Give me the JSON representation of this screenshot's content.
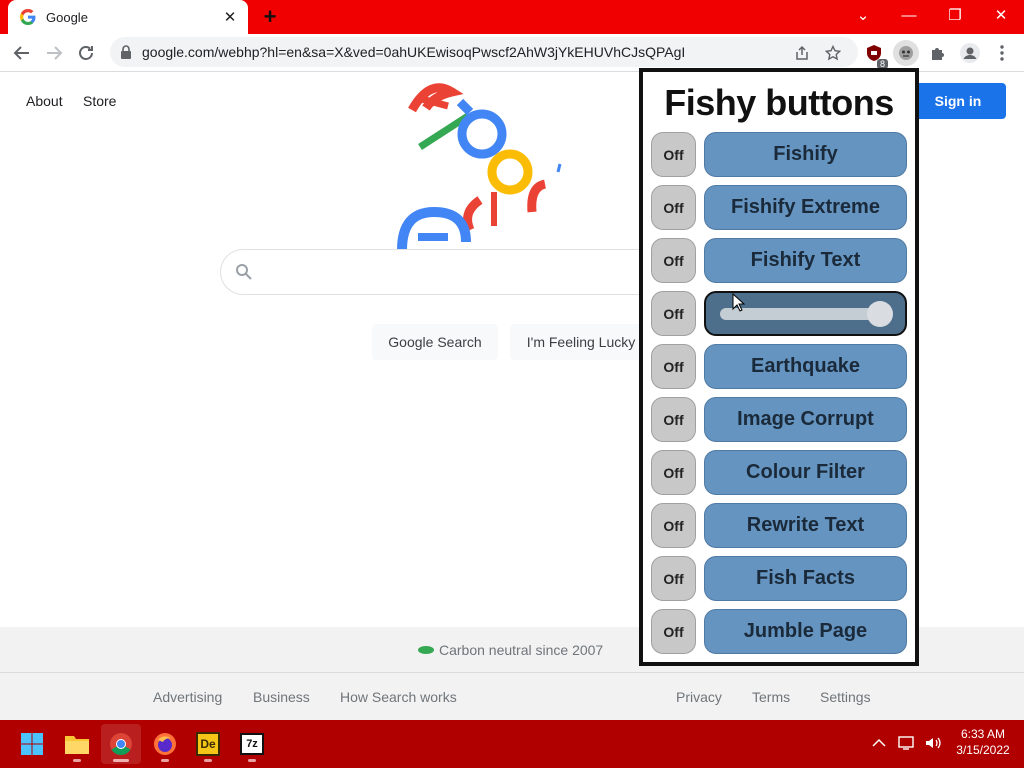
{
  "browser": {
    "tab": {
      "title": "Google",
      "close_glyph": "✕"
    },
    "new_tab_glyph": "+",
    "window_controls": {
      "dropdown": "⌄",
      "minimize": "—",
      "restore": "❐",
      "close": "✕"
    },
    "url": "google.com/webhp?hl=en&sa=X&ved=0ahUKEwisoqPwscf2AhW3jYkEHUVhCJsQPAgI",
    "extension_badge": "8"
  },
  "google": {
    "top_links": [
      "About",
      "Store"
    ],
    "signin_label": "Sign in",
    "buttons": {
      "search": "Google Search",
      "lucky": "I'm Feeling Lucky"
    },
    "footer": {
      "carbon_text": "Carbon neutral since 2007",
      "left_links": [
        "Advertising",
        "Business",
        "How Search works"
      ],
      "right_links": [
        "Privacy",
        "Terms",
        "Settings"
      ]
    }
  },
  "popup": {
    "title": "Fishy buttons",
    "rows": [
      {
        "off": "Off",
        "label": "Fishify",
        "kind": "button"
      },
      {
        "off": "Off",
        "label": "Fishify Extreme",
        "kind": "button"
      },
      {
        "off": "Off",
        "label": "Fishify Text",
        "kind": "button"
      },
      {
        "off": "Off",
        "label": "",
        "kind": "slider",
        "slider_value": 1.0
      },
      {
        "off": "Off",
        "label": "Earthquake",
        "kind": "button"
      },
      {
        "off": "Off",
        "label": "Image Corrupt",
        "kind": "button"
      },
      {
        "off": "Off",
        "label": "Colour Filter",
        "kind": "button"
      },
      {
        "off": "Off",
        "label": "Rewrite Text",
        "kind": "button"
      },
      {
        "off": "Off",
        "label": "Fish Facts",
        "kind": "button"
      },
      {
        "off": "Off",
        "label": "Jumble Page",
        "kind": "button"
      }
    ]
  },
  "taskbar": {
    "apps": [
      "windows-start-icon",
      "file-explorer-icon",
      "chrome-icon",
      "firefox-icon",
      "adobe-dreamweaver-icon",
      "7zip-icon"
    ],
    "dreamweaver_label": "De",
    "sevenzip_label": "7z",
    "clock": {
      "time": "6:33 AM",
      "date": "3/15/2022"
    }
  },
  "colors": {
    "tabstrip": "#f00000",
    "taskbar": "#b00000",
    "fishy_button": "#6494bf",
    "signin": "#1a73e8"
  }
}
